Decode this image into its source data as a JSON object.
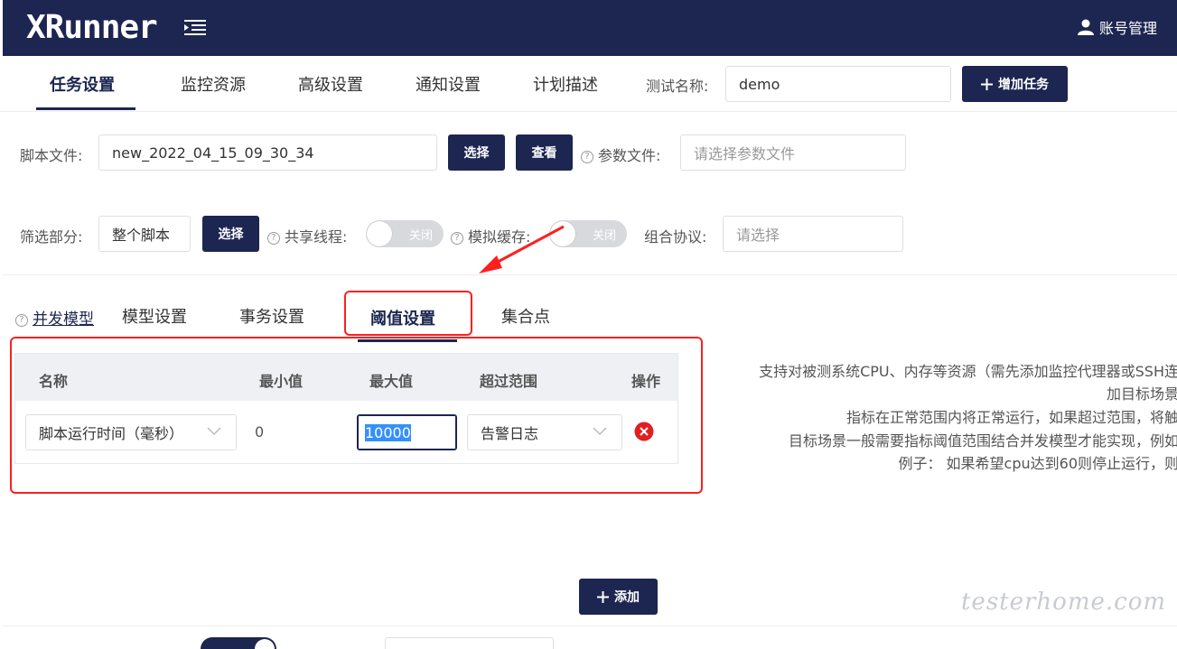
{
  "header": {
    "logo": "XRunner",
    "account_label": "账号管理"
  },
  "main_tabs": [
    {
      "label": "任务设置",
      "active": true
    },
    {
      "label": "监控资源",
      "active": false
    },
    {
      "label": "高级设置",
      "active": false
    },
    {
      "label": "通知设置",
      "active": false
    },
    {
      "label": "计划描述",
      "active": false
    }
  ],
  "test_name": {
    "label": "测试名称:",
    "value": "demo"
  },
  "add_task_button": "增加任务",
  "script_file": {
    "label": "脚本文件:",
    "value": "new_2022_04_15_09_30_34",
    "select_button": "选择",
    "view_button": "查看"
  },
  "param_file": {
    "label": "参数文件:",
    "placeholder": "请选择参数文件"
  },
  "filter_part": {
    "label": "筛选部分:",
    "value": "整个脚本",
    "select_button": "选择"
  },
  "shared_threads": {
    "label": "共享线程:",
    "state": "关闭"
  },
  "sim_cache": {
    "label": "模拟缓存:",
    "state": "关闭"
  },
  "combo_protocol": {
    "label": "组合协议:",
    "placeholder": "请选择"
  },
  "sub_tabs": {
    "concurrency_model": "并发模型",
    "items": [
      {
        "label": "模型设置",
        "active": false
      },
      {
        "label": "事务设置",
        "active": false
      },
      {
        "label": "阈值设置",
        "active": true
      },
      {
        "label": "集合点",
        "active": false
      }
    ]
  },
  "threshold_table": {
    "headers": [
      "名称",
      "最小值",
      "最大值",
      "超过范围",
      "操作"
    ],
    "rows": [
      {
        "name": "脚本运行时间（毫秒）",
        "min": "0",
        "max": "10000",
        "exceed": "告警日志"
      }
    ]
  },
  "add_button": "添加",
  "description_lines": [
    "支持对被测系统CPU、内存等资源（需先添加监控代理器或SSH连",
    "加目标场景",
    "指标在正常范围内将正常运行，如果超过范围，将触",
    "目标场景一般需要指标阈值范围结合并发模型才能实现，例如",
    "例子： 如果希望cpu达到60则停止运行，则"
  ],
  "watermark": "testerhome.com",
  "colors": {
    "brand": "#1d2651",
    "annotation_red": "#ff1f1f",
    "delete_red": "#e02020"
  }
}
